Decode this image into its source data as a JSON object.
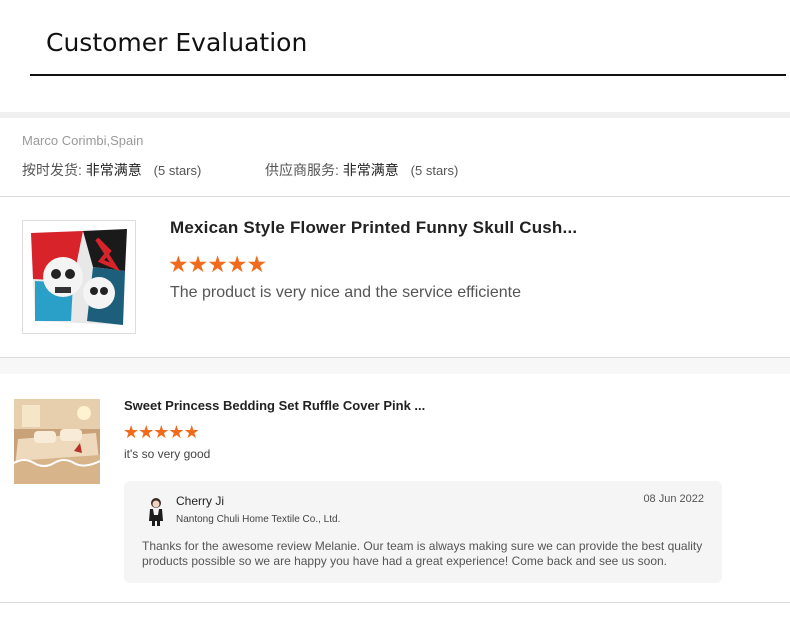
{
  "header": {
    "title": "Customer Evaluation"
  },
  "review": {
    "reviewer": "Marco Corimbi,Spain",
    "ratings": [
      {
        "label": "按时发货:",
        "value": "非常满意",
        "stars_text": "(5 stars)"
      },
      {
        "label": "供应商服务:",
        "value": "非常满意",
        "stars_text": "(5 stars)"
      }
    ],
    "product": {
      "title": "Mexican Style Flower Printed Funny Skull Cush...",
      "stars": 5,
      "comment": "The product is very nice and the service efficiente"
    }
  },
  "review2": {
    "product": {
      "title": "Sweet Princess Bedding Set Ruffle Cover Pink ...",
      "stars": 5,
      "comment": "it's so very good"
    },
    "reply": {
      "name": "Cherry Ji",
      "company": "Nantong Chuli Home Textile Co., Ltd.",
      "date": "08 Jun 2022",
      "text": "Thanks for the awesome review Melanie. Our team is always making sure we can provide the best quality products possible so we are happy you have had a great experience! Come back and see us soon."
    }
  },
  "colors": {
    "star": "#f26a1b",
    "reply_bg": "#f5f5f5"
  },
  "icons": {
    "star": "star-icon",
    "avatar": "seller-avatar"
  }
}
